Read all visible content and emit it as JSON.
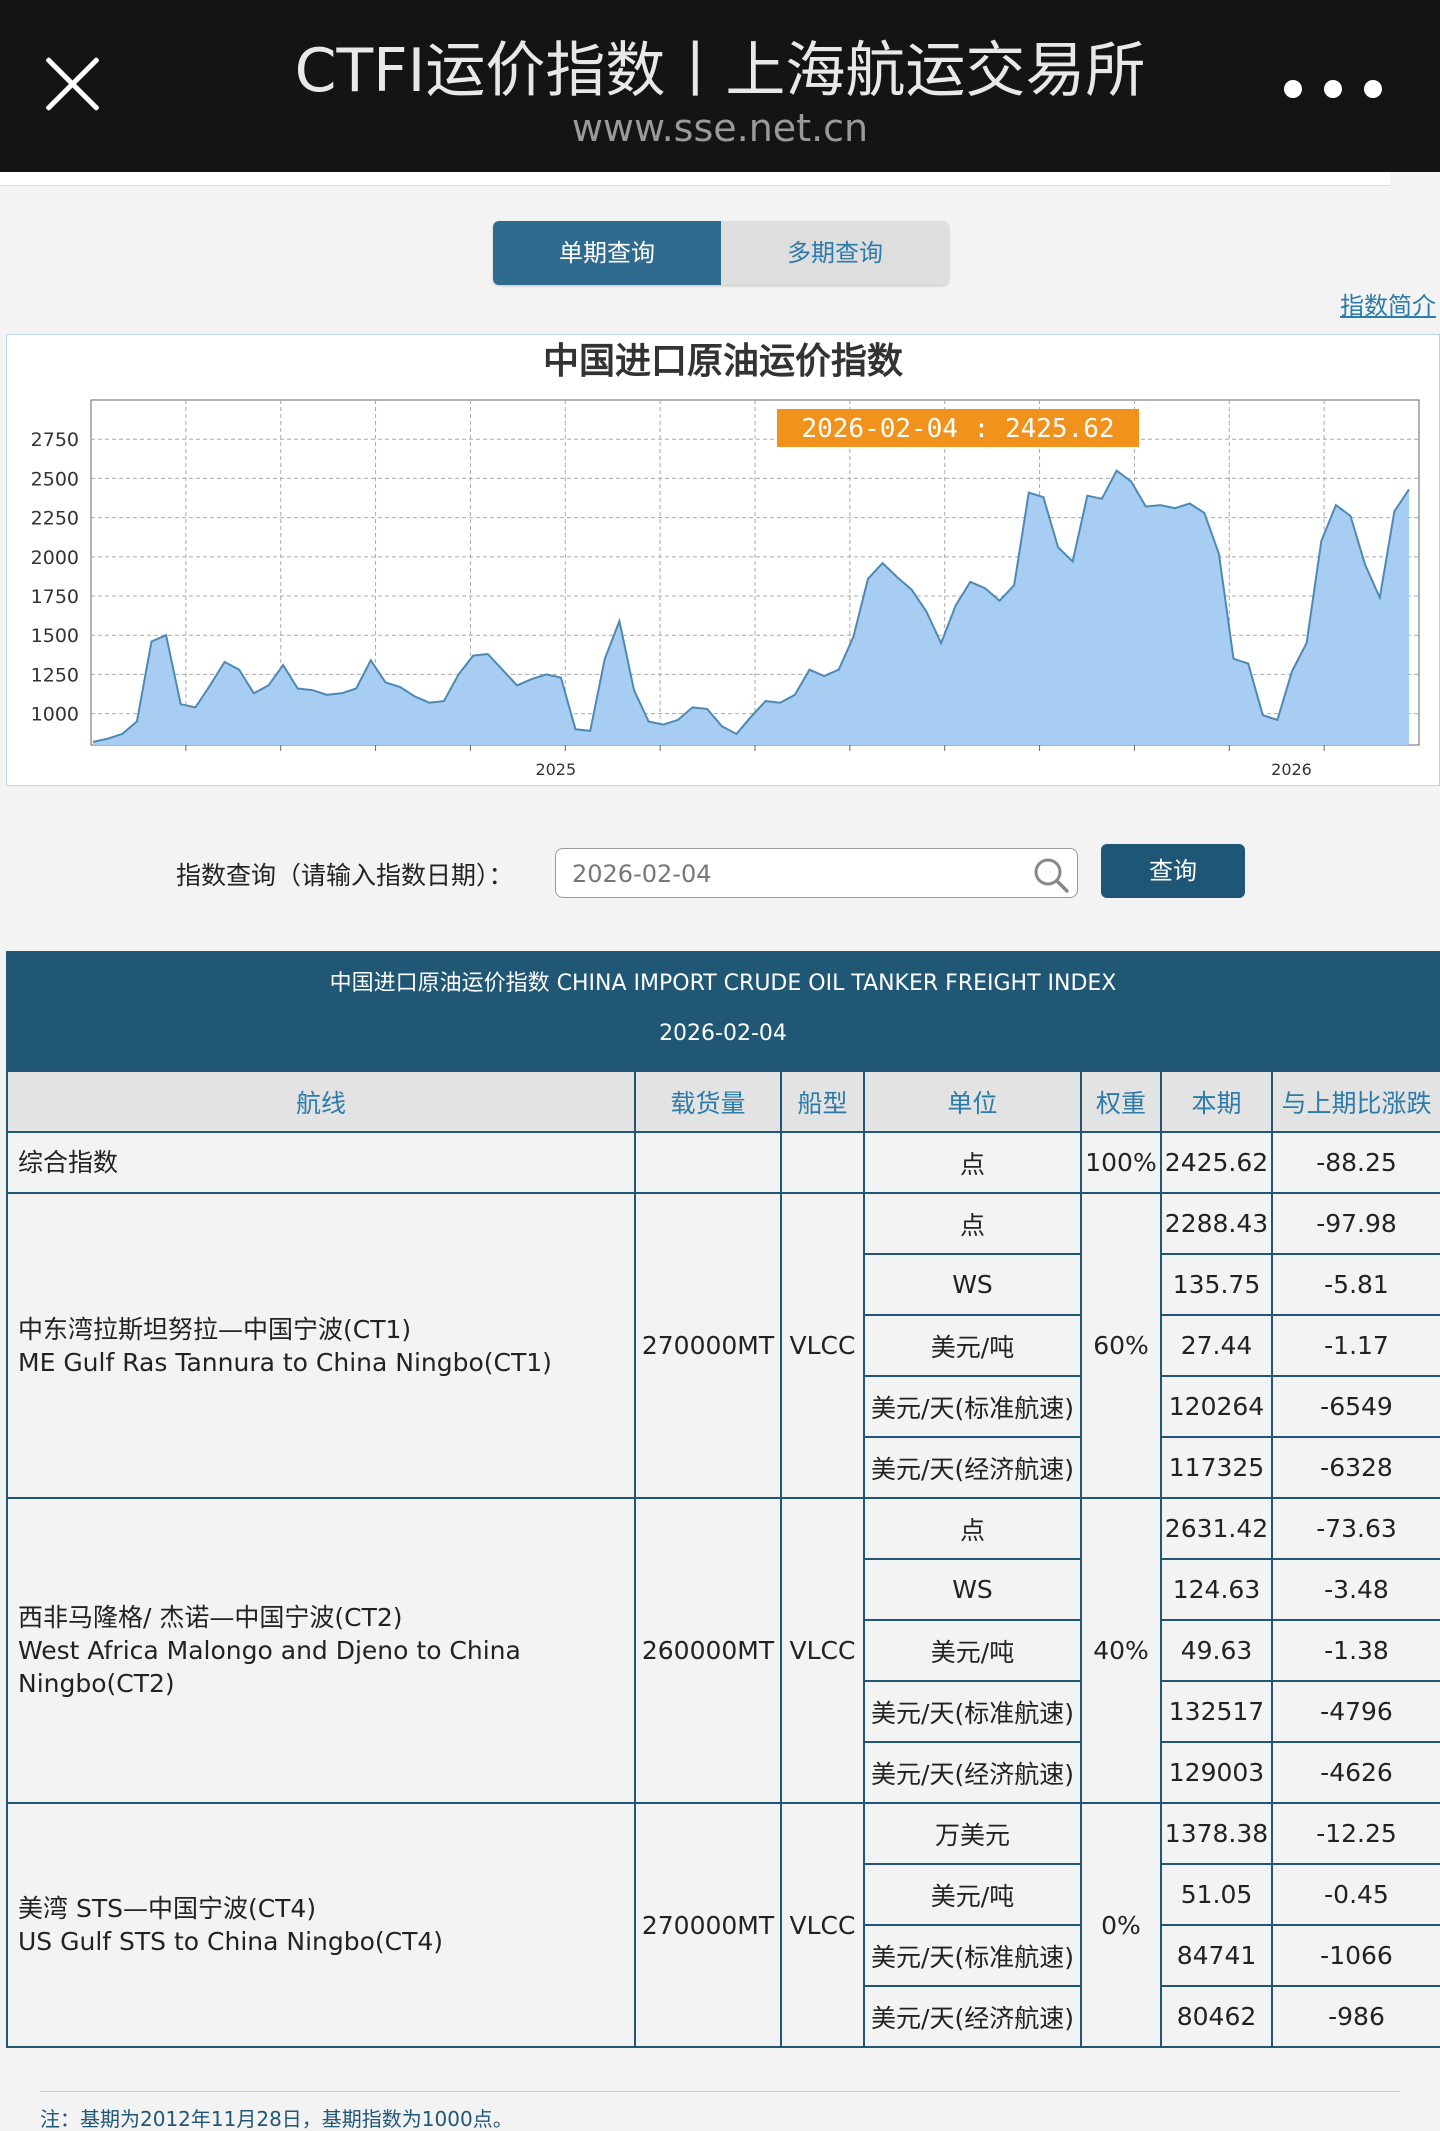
{
  "appbar": {
    "title": "CTFI运价指数丨上海航运交易所",
    "url": "www.sse.net.cn"
  },
  "tabs": [
    {
      "label": "单期查询",
      "active": true
    },
    {
      "label": "多期查询",
      "active": false
    }
  ],
  "intro_link": "指数简介",
  "chart_data": {
    "type": "area",
    "title": "中国进口原油运价指数",
    "tooltip": "2026-02-04 : 2425.62",
    "yticks": [
      1000,
      1250,
      1500,
      1750,
      2000,
      2250,
      2500,
      2750
    ],
    "xtick_labels": [
      "2025",
      "2026"
    ],
    "ylim": [
      800,
      3000
    ],
    "grid": true,
    "fill_color": "#a7cdf3",
    "line_color": "#4d89b3",
    "series": [
      {
        "values": [
          820,
          840,
          870,
          950,
          1460,
          1500,
          1060,
          1040,
          1180,
          1330,
          1280,
          1130,
          1180,
          1310,
          1160,
          1150,
          1120,
          1130,
          1160,
          1340,
          1200,
          1170,
          1110,
          1070,
          1080,
          1250,
          1370,
          1380,
          1280,
          1180,
          1220,
          1250,
          1230,
          900,
          890,
          1350,
          1590,
          1150,
          950,
          930,
          960,
          1040,
          1030,
          920,
          870,
          980,
          1080,
          1070,
          1120,
          1280,
          1240,
          1280,
          1490,
          1860,
          1960,
          1870,
          1790,
          1650,
          1450,
          1690,
          1840,
          1800,
          1720,
          1820,
          2410,
          2380,
          2060,
          1970,
          2390,
          2370,
          2550,
          2480,
          2320,
          2330,
          2310,
          2340,
          2280,
          2020,
          1350,
          1320,
          990,
          960,
          1270,
          1450,
          2100,
          2330,
          2260,
          1950,
          1740,
          2290,
          2430
        ]
      }
    ]
  },
  "query": {
    "label": "指数查询（请输入指数日期）：",
    "value": "2026-02-04",
    "button": "查询"
  },
  "table": {
    "title": "中国进口原油运价指数 CHINA IMPORT CRUDE OIL TANKER FREIGHT INDEX",
    "date": "2026-02-04",
    "headers": [
      "航线",
      "载货量",
      "船型",
      "单位",
      "权重",
      "本期",
      "与上期比涨跌"
    ],
    "summary": {
      "name": "综合指数",
      "unit": "点",
      "weight": "100%",
      "current": "2425.62",
      "change": "-88.25"
    },
    "routes": [
      {
        "name_cn": "中东湾拉斯坦努拉—中国宁波(CT1)",
        "name_en": "ME Gulf Ras Tannura to China Ningbo(CT1)",
        "cargo": "270000MT",
        "ship": "VLCC",
        "weight": "60%",
        "rows": [
          {
            "unit": "点",
            "current": "2288.43",
            "change": "-97.98"
          },
          {
            "unit": "WS",
            "current": "135.75",
            "change": "-5.81"
          },
          {
            "unit": "美元/吨",
            "current": "27.44",
            "change": "-1.17"
          },
          {
            "unit": "美元/天(标准航速)",
            "current": "120264",
            "change": "-6549"
          },
          {
            "unit": "美元/天(经济航速)",
            "current": "117325",
            "change": "-6328"
          }
        ]
      },
      {
        "name_cn": "西非马隆格/ 杰诺—中国宁波(CT2)",
        "name_en": "West Africa Malongo and Djeno to China Ningbo(CT2)",
        "cargo": "260000MT",
        "ship": "VLCC",
        "weight": "40%",
        "rows": [
          {
            "unit": "点",
            "current": "2631.42",
            "change": "-73.63"
          },
          {
            "unit": "WS",
            "current": "124.63",
            "change": "-3.48"
          },
          {
            "unit": "美元/吨",
            "current": "49.63",
            "change": "-1.38"
          },
          {
            "unit": "美元/天(标准航速)",
            "current": "132517",
            "change": "-4796"
          },
          {
            "unit": "美元/天(经济航速)",
            "current": "129003",
            "change": "-4626"
          }
        ]
      },
      {
        "name_cn": "美湾 STS—中国宁波(CT4)",
        "name_en": "US Gulf STS to China Ningbo(CT4)",
        "cargo": "270000MT",
        "ship": "VLCC",
        "weight": "0%",
        "rows": [
          {
            "unit": "万美元",
            "current": "1378.38",
            "change": "-12.25"
          },
          {
            "unit": "美元/吨",
            "current": "51.05",
            "change": "-0.45"
          },
          {
            "unit": "美元/天(标准航速)",
            "current": "84741",
            "change": "-1066"
          },
          {
            "unit": "美元/天(经济航速)",
            "current": "80462",
            "change": "-986"
          }
        ]
      }
    ]
  },
  "footnote": "注：基期为2012年11月28日，基期指数为1000点。"
}
